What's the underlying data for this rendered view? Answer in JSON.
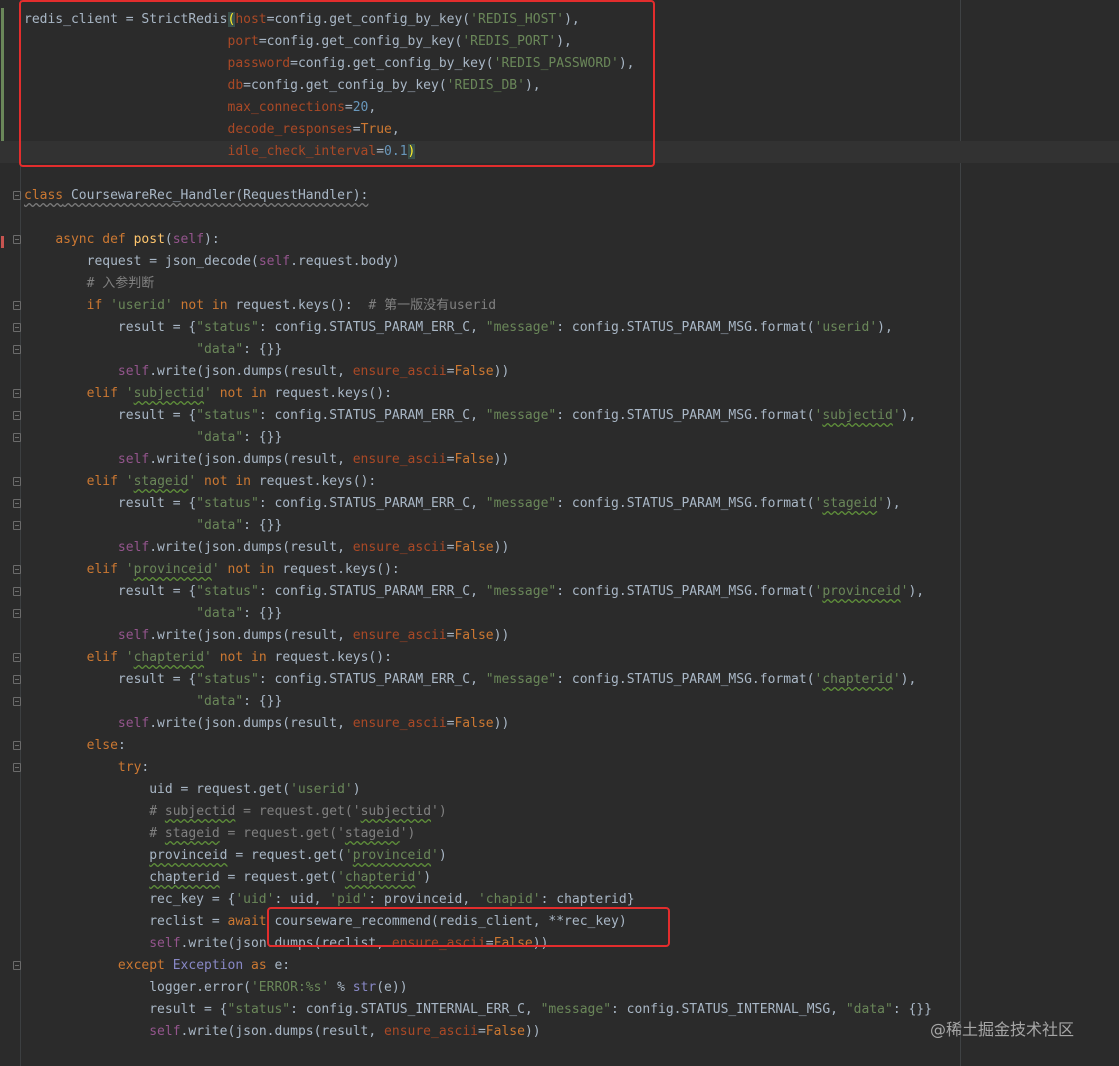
{
  "editor": {
    "lines": [
      {
        "html": "redis_client = StrictRedis<span class='brace'>(</span><span class='param'>host</span>=config.get_config_by_key(<span class='str'>'REDIS_HOST'</span>),"
      },
      {
        "html": "                          <span class='param'>port</span>=config.get_config_by_key(<span class='str'>'REDIS_PORT'</span>),"
      },
      {
        "html": "                          <span class='param'>password</span>=config.get_config_by_key(<span class='str'>'REDIS_PASSWORD'</span>),"
      },
      {
        "html": "                          <span class='param'>db</span>=config.get_config_by_key(<span class='str'>'REDIS_DB'</span>),"
      },
      {
        "html": "                          <span class='param'>max_connections</span>=<span class='num'>20</span>,"
      },
      {
        "html": "                          <span class='param'>decode_responses</span>=<span class='kw'>True</span>,"
      },
      {
        "html": "                          <span class='param'>idle_check_interval</span>=<span class='num'>0.1</span><span class='brace'>)</span>",
        "hl": true
      },
      {
        "html": ""
      },
      {
        "html": "<span class='kw ulgray'>class</span><span class='ulgray'> CoursewareRec_Handler(RequestHandler):</span>",
        "fold": true
      },
      {
        "html": ""
      },
      {
        "html": "    <span class='kw'>async def</span> <span class='fn'>post</span>(<span class='self'>self</span>):",
        "fold": true
      },
      {
        "html": "        request = json_decode(<span class='self'>self</span>.request.body)"
      },
      {
        "html": "        <span class='cmt'># 入参判断</span>"
      },
      {
        "html": "        <span class='kw'>if</span> <span class='str'>'userid'</span> <span class='kw'>not in</span> request.keys():  <span class='cmt'># 第一版没有userid</span>",
        "fold": true
      },
      {
        "html": "            result = {<span class='str'>\"status\"</span>: config.STATUS_PARAM_ERR_C, <span class='str'>\"message\"</span>: config.STATUS_PARAM_MSG.format(<span class='str'>'userid'</span>),",
        "fold": true
      },
      {
        "html": "                      <span class='str'>\"data\"</span>: {}}",
        "fold": true
      },
      {
        "html": "            <span class='self'>self</span>.write(json.dumps(result, <span class='param'>ensure_ascii</span>=<span class='kw'>False</span>))"
      },
      {
        "html": "        <span class='kw'>elif</span> <span class='str'>'<span class='ul'>subjectid</span>'</span> <span class='kw'>not in</span> request.keys():",
        "fold": true
      },
      {
        "html": "            result = {<span class='str'>\"status\"</span>: config.STATUS_PARAM_ERR_C, <span class='str'>\"message\"</span>: config.STATUS_PARAM_MSG.format(<span class='str'>'<span class='ul'>subjectid</span>'</span>),",
        "fold": true
      },
      {
        "html": "                      <span class='str'>\"data\"</span>: {}}",
        "fold": true
      },
      {
        "html": "            <span class='self'>self</span>.write(json.dumps(result, <span class='param'>ensure_ascii</span>=<span class='kw'>False</span>))"
      },
      {
        "html": "        <span class='kw'>elif</span> <span class='str'>'<span class='ul'>stageid</span>'</span> <span class='kw'>not in</span> request.keys():",
        "fold": true
      },
      {
        "html": "            result = {<span class='str'>\"status\"</span>: config.STATUS_PARAM_ERR_C, <span class='str'>\"message\"</span>: config.STATUS_PARAM_MSG.format(<span class='str'>'<span class='ul'>stageid</span>'</span>),",
        "fold": true
      },
      {
        "html": "                      <span class='str'>\"data\"</span>: {}}",
        "fold": true
      },
      {
        "html": "            <span class='self'>self</span>.write(json.dumps(result, <span class='param'>ensure_ascii</span>=<span class='kw'>False</span>))"
      },
      {
        "html": "        <span class='kw'>elif</span> <span class='str'>'<span class='ul'>provinceid</span>'</span> <span class='kw'>not in</span> request.keys():",
        "fold": true
      },
      {
        "html": "            result = {<span class='str'>\"status\"</span>: config.STATUS_PARAM_ERR_C, <span class='str'>\"message\"</span>: config.STATUS_PARAM_MSG.format(<span class='str'>'<span class='ul'>provinceid</span>'</span>),",
        "fold": true
      },
      {
        "html": "                      <span class='str'>\"data\"</span>: {}}",
        "fold": true
      },
      {
        "html": "            <span class='self'>self</span>.write(json.dumps(result, <span class='param'>ensure_ascii</span>=<span class='kw'>False</span>))"
      },
      {
        "html": "        <span class='kw'>elif</span> <span class='str'>'<span class='ul'>chapterid</span>'</span> <span class='kw'>not in</span> request.keys():",
        "fold": true
      },
      {
        "html": "            result = {<span class='str'>\"status\"</span>: config.STATUS_PARAM_ERR_C, <span class='str'>\"message\"</span>: config.STATUS_PARAM_MSG.format(<span class='str'>'<span class='ul'>chapterid</span>'</span>),",
        "fold": true
      },
      {
        "html": "                      <span class='str'>\"data\"</span>: {}}",
        "fold": true
      },
      {
        "html": "            <span class='self'>self</span>.write(json.dumps(result, <span class='param'>ensure_ascii</span>=<span class='kw'>False</span>))"
      },
      {
        "html": "        <span class='kw'>else</span>:",
        "fold": true
      },
      {
        "html": "            <span class='kw'>try</span>:",
        "fold": true
      },
      {
        "html": "                uid = request.get(<span class='str'>'userid'</span>)"
      },
      {
        "html": "                <span class='cmt'># <span class='ul'>subjectid</span> = request.get('<span class='ul'>subjectid</span>')</span>"
      },
      {
        "html": "                <span class='cmt'># <span class='ul'>stageid</span> = request.get('<span class='ul'>stageid</span>')</span>"
      },
      {
        "html": "                <span class='ul'>provinceid</span> = request.get(<span class='str'>'<span class='ul'>provinceid</span>'</span>)"
      },
      {
        "html": "                <span class='ul'>chapterid</span> = request.get(<span class='str'>'<span class='ul'>chapterid</span>'</span>)"
      },
      {
        "html": "                rec_key = {<span class='str'>'uid'</span>: uid, <span class='str'>'pid'</span>: provinceid, <span class='str'>'chapid'</span>: chapterid}"
      },
      {
        "html": "                reclist = <span class='kw'>await</span> courseware_recommend(redis_client, **rec_key)"
      },
      {
        "html": "                <span class='self'>self</span>.write(json.dumps(reclist, <span class='param'>ensure_ascii</span>=<span class='kw'>False</span>))"
      },
      {
        "html": "            <span class='kw'>except</span> <span class='cls'>Exception</span> <span class='kw'>as</span> e:",
        "fold": true
      },
      {
        "html": "                logger.error(<span class='str'>'ERROR:%s'</span> % <span class='cls'>str</span>(e))"
      },
      {
        "html": "                result = {<span class='str'>\"status\"</span>: config.STATUS_INTERNAL_ERR_C, <span class='str'>\"message\"</span>: config.STATUS_INTERNAL_MSG, <span class='str'>\"data\"</span>: {}}"
      },
      {
        "html": "                <span class='self'>self</span>.write(json.dumps(result, <span class='param'>ensure_ascii</span>=<span class='kw'>False</span>))"
      }
    ]
  },
  "watermark": "@稀土掘金技术社区"
}
